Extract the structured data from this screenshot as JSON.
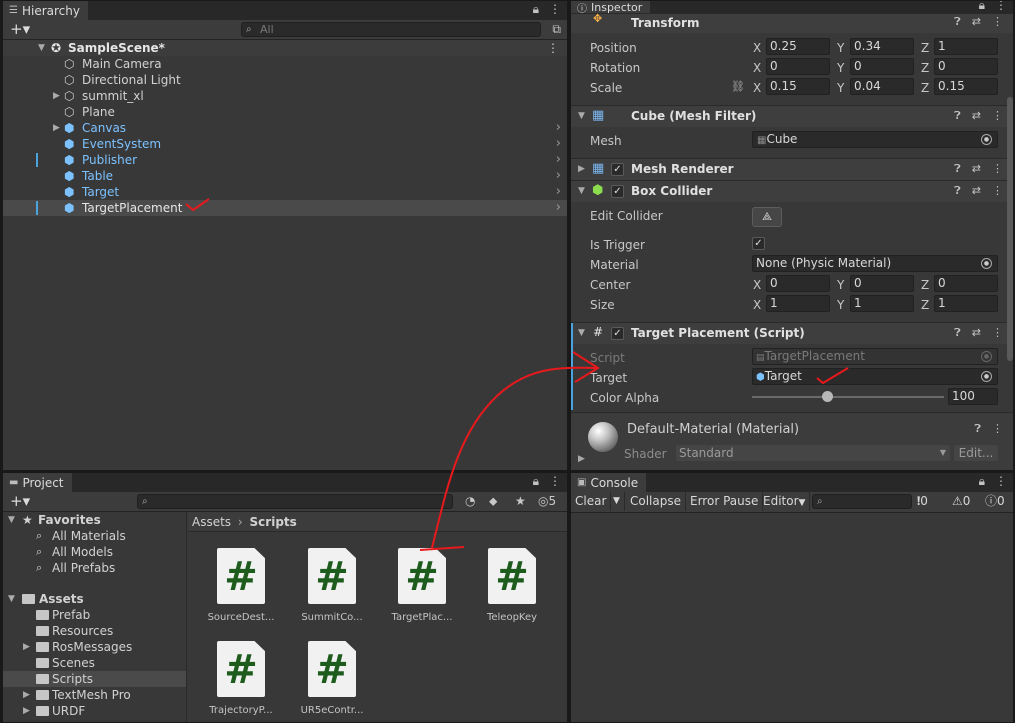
{
  "hierarchy": {
    "tab": "Hierarchy",
    "search_placeholder": "All",
    "scene": "SampleScene*",
    "items": [
      {
        "label": "Main Camera"
      },
      {
        "label": "Directional Light"
      },
      {
        "label": "summit_xl"
      },
      {
        "label": "Plane"
      },
      {
        "label": "Canvas"
      },
      {
        "label": "EventSystem"
      },
      {
        "label": "Publisher"
      },
      {
        "label": "Table"
      },
      {
        "label": "Target"
      },
      {
        "label": "TargetPlacement"
      }
    ]
  },
  "inspector": {
    "tab": "Inspector",
    "transform": {
      "title": "Transform",
      "position_label": "Position",
      "rotation_label": "Rotation",
      "scale_label": "Scale",
      "position": {
        "x": "0.25",
        "y": "0.34",
        "z": "1"
      },
      "rotation": {
        "x": "0",
        "y": "0",
        "z": "0"
      },
      "scale": {
        "x": "0.15",
        "y": "0.04",
        "z": "0.15"
      }
    },
    "mesh_filter": {
      "title": "Cube (Mesh Filter)",
      "mesh_label": "Mesh",
      "mesh_value": "Cube"
    },
    "mesh_renderer": {
      "title": "Mesh Renderer"
    },
    "box_collider": {
      "title": "Box Collider",
      "edit_label": "Edit Collider",
      "trigger_label": "Is Trigger",
      "material_label": "Material",
      "material_value": "None (Physic Material)",
      "center_label": "Center",
      "size_label": "Size",
      "center": {
        "x": "0",
        "y": "0",
        "z": "0"
      },
      "size": {
        "x": "1",
        "y": "1",
        "z": "1"
      }
    },
    "target_placement": {
      "title": "Target Placement (Script)",
      "script_label": "Script",
      "script_value": "TargetPlacement",
      "target_label": "Target",
      "target_value": "Target",
      "alpha_label": "Color Alpha",
      "alpha_value": "100",
      "alpha_fraction": 0.39
    },
    "material": {
      "name": "Default-Material (Material)",
      "shader_label": "Shader",
      "shader_value": "Standard",
      "edit_button": "Edit..."
    },
    "axis_x": "X",
    "axis_y": "Y",
    "axis_z": "Z"
  },
  "project": {
    "tab": "Project",
    "hidden_count": "5",
    "favorites_label": "Favorites",
    "favorites": [
      {
        "label": "All Materials"
      },
      {
        "label": "All Models"
      },
      {
        "label": "All Prefabs"
      }
    ],
    "assets_label": "Assets",
    "folders": [
      {
        "label": "Prefab"
      },
      {
        "label": "Resources"
      },
      {
        "label": "RosMessages"
      },
      {
        "label": "Scenes"
      },
      {
        "label": "Scripts"
      },
      {
        "label": "TextMesh Pro"
      },
      {
        "label": "URDF"
      }
    ],
    "breadcrumb_root": "Assets",
    "breadcrumb_current": "Scripts",
    "files": [
      {
        "name": "SourceDest..."
      },
      {
        "name": "SummitCo..."
      },
      {
        "name": "TargetPlac..."
      },
      {
        "name": "TeleopKey"
      },
      {
        "name": "TrajectoryP..."
      },
      {
        "name": "UR5eContr..."
      }
    ],
    "file_glyph": "#"
  },
  "console": {
    "tab": "Console",
    "clear": "Clear",
    "collapse": "Collapse",
    "error_pause": "Error Pause",
    "editor": "Editor",
    "errors": "0",
    "warnings": "0",
    "infos": "0"
  },
  "colors": {
    "accent": "#7cc2ff",
    "annotation": "#e8191c",
    "script_glyph": "#1d5c1d"
  }
}
